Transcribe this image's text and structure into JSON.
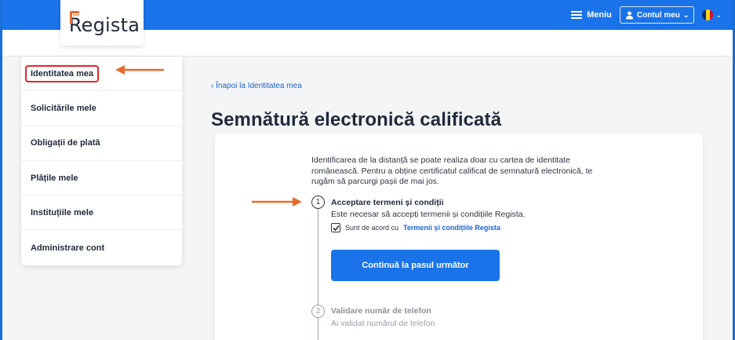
{
  "header": {
    "logo_text": "Regista",
    "menu_label": "Meniu",
    "account_label": "Contul meu",
    "language_flag": "romania-flag",
    "colors": {
      "topbar": "#1a73e8",
      "accent_red": "#e0272b",
      "arrow": "#ea6a2c"
    }
  },
  "sidebar": {
    "items": [
      {
        "label": "Identitatea mea",
        "active": true
      },
      {
        "label": "Solicitările mele"
      },
      {
        "label": "Obligații de plată"
      },
      {
        "label": "Plățile mele"
      },
      {
        "label": "Instituțiile mele"
      },
      {
        "label": "Administrare cont"
      }
    ]
  },
  "main": {
    "back_link": "‹ Înapoi la Identitatea mea",
    "title": "Semnătură electronică calificată",
    "intro": "Identificarea de la distanță se poate realiza doar cu cartea de identitate românească. Pentru a obține certificatul calificat de semnatură electronică, te rugăm să parcurgi pașii de mai jos.",
    "steps": [
      {
        "number": "1",
        "title": "Acceptare termeni și condiții",
        "description": "Este necesar să accepți termenii și condițiile Regista.",
        "checkbox_checked": true,
        "checkbox_label": "Sunt de acord cu",
        "terms_link": "Termenii și condițiile Regista",
        "button_label": "Continuă la pasul următor"
      },
      {
        "number": "2",
        "title": "Validare număr de telefon",
        "description": "Ai validat numărul de telefon"
      }
    ]
  }
}
